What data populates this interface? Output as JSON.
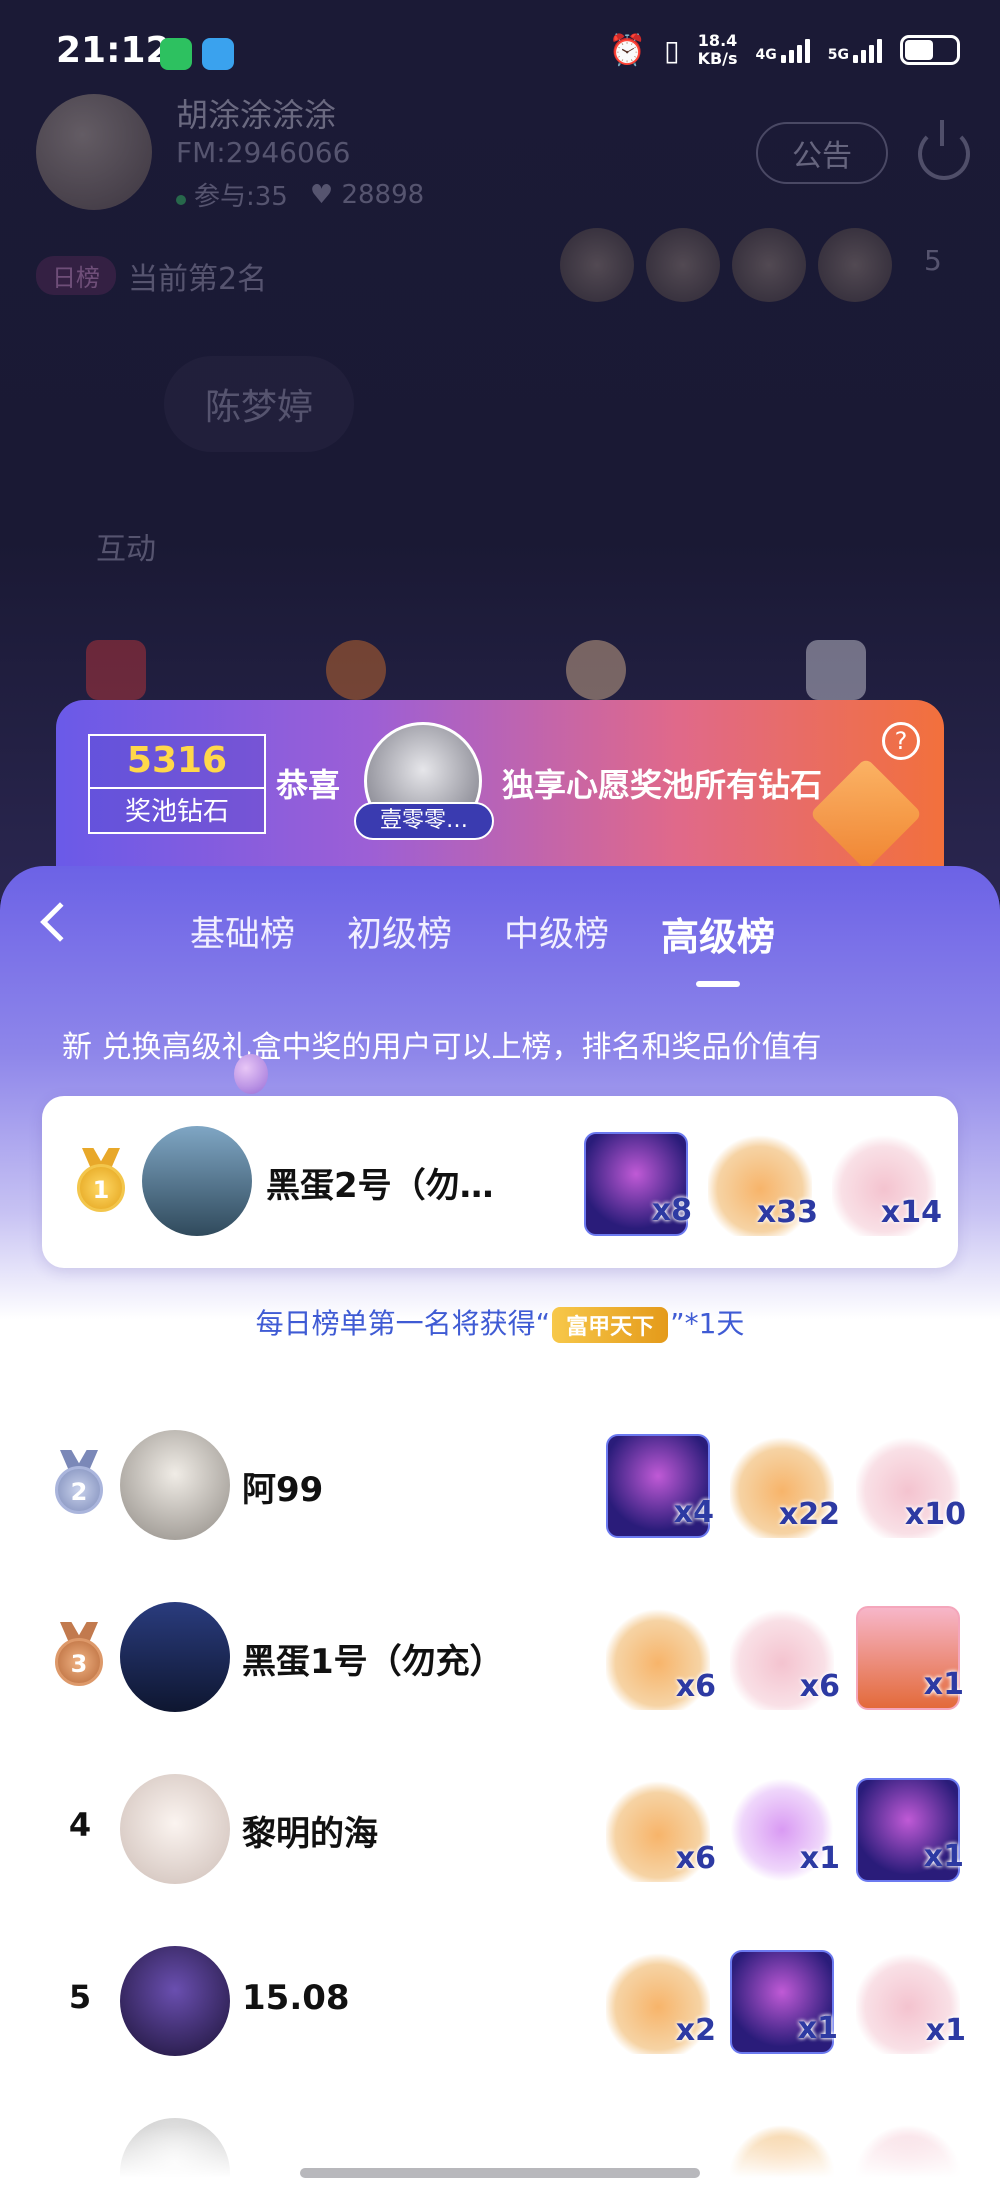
{
  "status_bar": {
    "time": "21:12",
    "net_speed_value": "18.4",
    "net_speed_unit": "KB/s",
    "net_4g": "4G",
    "net_5g": "5G"
  },
  "room": {
    "host_name": "胡涂涂涂涂",
    "fm_id": "FM:2946066",
    "participants": "参与:35",
    "likes": "28898",
    "notice_button": "公告",
    "rank_tag": "日榜",
    "rank_text": "当前第2名",
    "fans_count": "5",
    "seat_name": "陈梦婷",
    "interact_label": "互动"
  },
  "wish_pool": {
    "pool_value": "5316",
    "pool_label": "奖池钻石",
    "congrats": "恭喜",
    "winner_name": "壹零零…",
    "exclusive_text": "独享心愿奖池所有钻石",
    "help_icon": "?"
  },
  "leaderboard": {
    "tabs": [
      {
        "label": "基础榜",
        "active": false
      },
      {
        "label": "初级榜",
        "active": false
      },
      {
        "label": "中级榜",
        "active": false
      },
      {
        "label": "高级榜",
        "active": true
      }
    ],
    "marquee": "新 兑换高级礼盒中奖的用户可以上榜，排名和奖品价值有",
    "daily_prefix": "每日榜单第一名将获得“",
    "daily_badge": "富甲天下",
    "daily_suffix": "”*1天",
    "entries": [
      {
        "rank": "1",
        "name": "黑蛋2号（勿…",
        "gifts": [
          {
            "icon": "dj-girl-gift",
            "qty": "x8"
          },
          {
            "icon": "cat-gift",
            "qty": "x33"
          },
          {
            "icon": "bear-gift",
            "qty": "x14"
          }
        ]
      },
      {
        "rank": "2",
        "name": "阿99",
        "gifts": [
          {
            "icon": "dj-girl-gift",
            "qty": "x4"
          },
          {
            "icon": "cat-gift",
            "qty": "x22"
          },
          {
            "icon": "bear-gift",
            "qty": "x10"
          }
        ]
      },
      {
        "rank": "3",
        "name": "黑蛋1号（勿充）",
        "gifts": [
          {
            "icon": "cat-gift",
            "qty": "x6"
          },
          {
            "icon": "bear-gift",
            "qty": "x6"
          },
          {
            "icon": "fox-gift",
            "qty": "x1"
          }
        ]
      },
      {
        "rank": "4",
        "name": "黎明的海",
        "gifts": [
          {
            "icon": "cat-gift",
            "qty": "x6"
          },
          {
            "icon": "heart-arrow-gift",
            "qty": "x1"
          },
          {
            "icon": "dj-girl-gift",
            "qty": "x1"
          }
        ]
      },
      {
        "rank": "5",
        "name": "15.08",
        "gifts": [
          {
            "icon": "cat-gift",
            "qty": "x2"
          },
          {
            "icon": "dj-girl-gift",
            "qty": "x1"
          },
          {
            "icon": "bear-gift",
            "qty": "x1"
          }
        ]
      }
    ]
  }
}
